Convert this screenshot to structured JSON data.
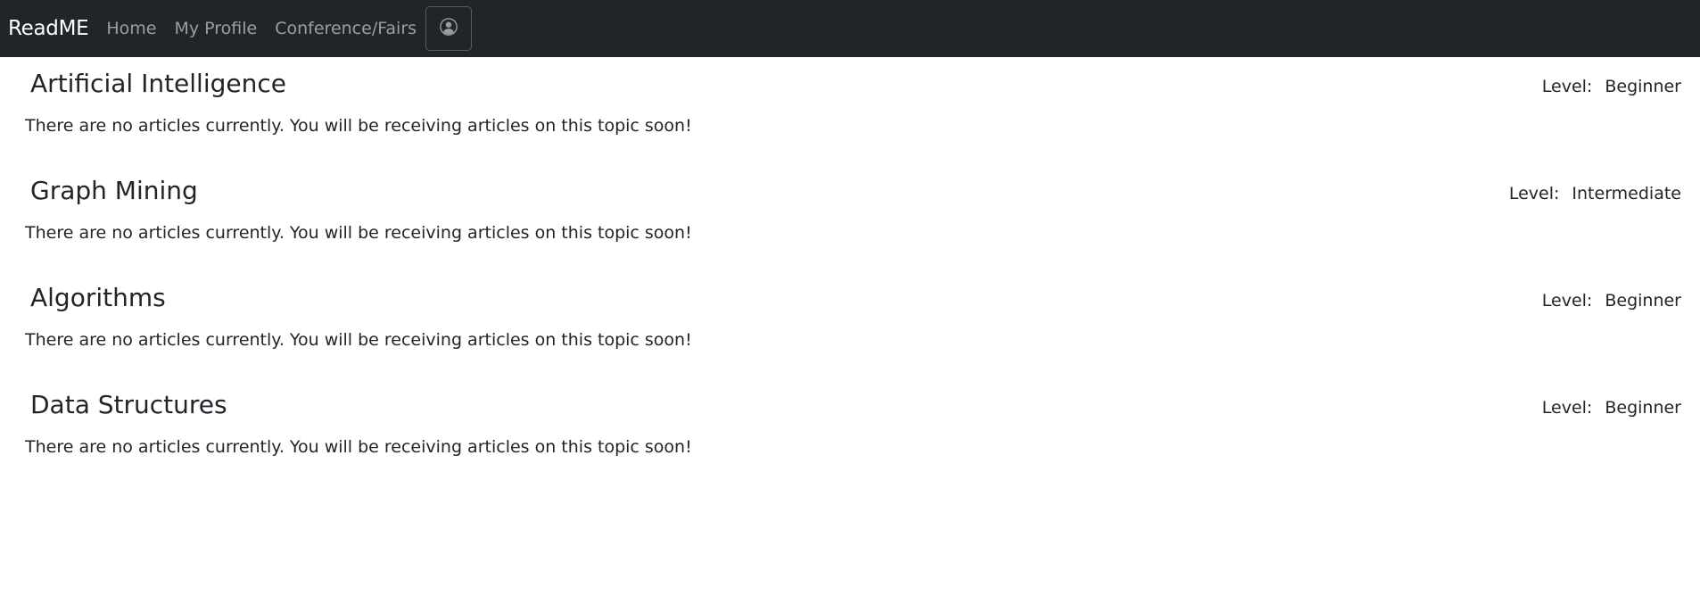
{
  "navbar": {
    "brand": "ReadME",
    "links": [
      {
        "label": "Home"
      },
      {
        "label": "My Profile"
      },
      {
        "label": "Conference/Fairs"
      }
    ],
    "profile_icon": "person-circle-icon"
  },
  "topics": [
    {
      "title": "Artificial Intelligence",
      "level_label": "Level:",
      "level_value": "Beginner",
      "message": "There are no articles currently. You will be receiving articles on this topic soon!"
    },
    {
      "title": "Graph Mining",
      "level_label": "Level:",
      "level_value": "Intermediate",
      "message": "There are no articles currently. You will be receiving articles on this topic soon!"
    },
    {
      "title": "Algorithms",
      "level_label": "Level:",
      "level_value": "Beginner",
      "message": "There are no articles currently. You will be receiving articles on this topic soon!"
    },
    {
      "title": "Data Structures",
      "level_label": "Level:",
      "level_value": "Beginner",
      "message": "There are no articles currently. You will be receiving articles on this topic soon!"
    }
  ],
  "colors": {
    "navbar_bg": "#212529",
    "brand": "#ffffff",
    "nav_link": "#8c8f93",
    "text": "#212529"
  }
}
